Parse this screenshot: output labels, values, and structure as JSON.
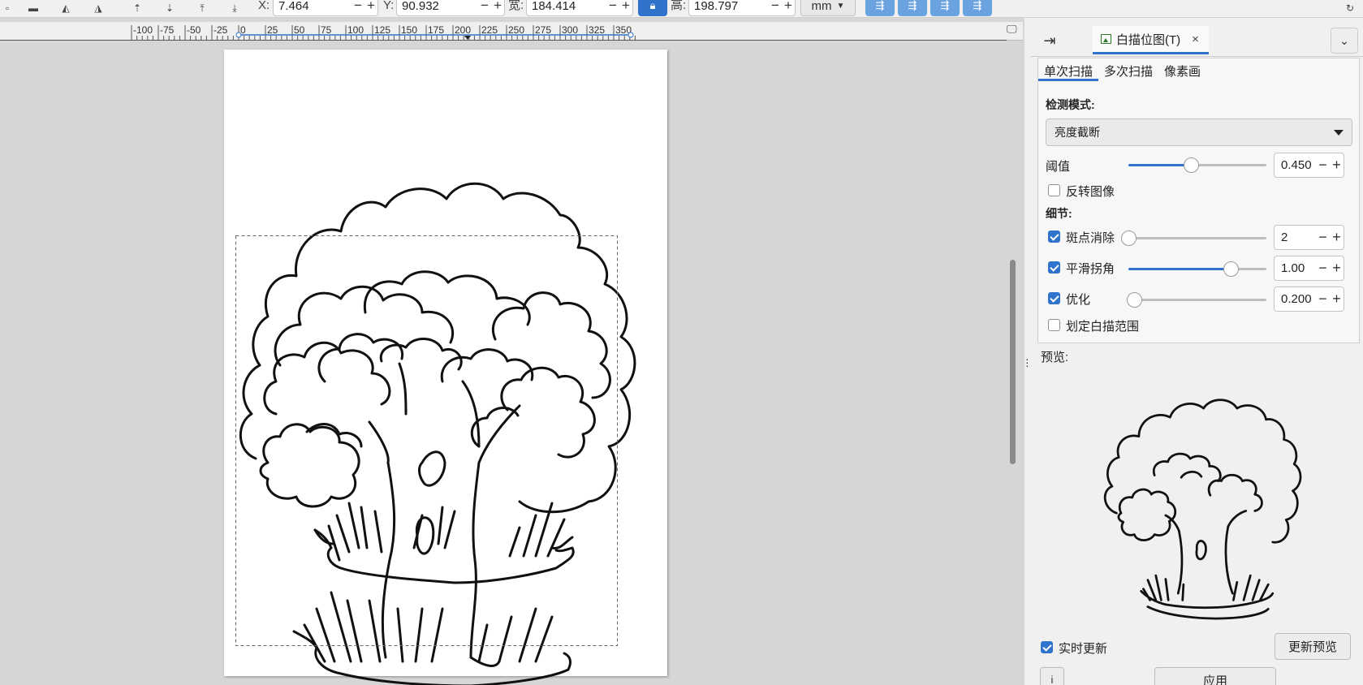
{
  "toolbar": {
    "x_label": "X:",
    "x_value": "7.464",
    "y_label": "Y:",
    "y_value": "90.932",
    "w_label": "宽:",
    "w_value": "184.414",
    "h_label": "高:",
    "h_value": "198.797",
    "unit": "mm",
    "minus": "−",
    "plus": "+"
  },
  "ruler": {
    "ticks": [
      "-100",
      "-75",
      "-50",
      "-25",
      "0",
      "25",
      "50",
      "75",
      "100",
      "125",
      "150",
      "175",
      "200",
      "225",
      "250",
      "275",
      "300",
      "325",
      "350"
    ]
  },
  "dock": {
    "active_tab": "白描位图(T)",
    "close": "×",
    "mode_tabs": [
      "单次扫描",
      "多次扫描",
      "像素画"
    ],
    "detection_label": "检测模式:",
    "detection_value": "亮度截断",
    "threshold_label": "阈值",
    "threshold_value": "0.450",
    "threshold_fraction": 0.45,
    "invert_label": "反转图像",
    "invert_checked": false,
    "details_label": "细节:",
    "speckles_label": "斑点消除",
    "speckles_value": "2",
    "speckles_checked": true,
    "speckles_fraction": 0.0,
    "smooth_label": "平滑拐角",
    "smooth_value": "1.00",
    "smooth_checked": true,
    "smooth_fraction": 0.74,
    "optimize_label": "优化",
    "optimize_value": "0.200",
    "optimize_checked": true,
    "optimize_fraction": 0.04,
    "area_label": "划定白描范围",
    "area_checked": false,
    "preview_label": "预览:",
    "live_update_label": "实时更新",
    "live_update_checked": true,
    "update_preview_button": "更新预览",
    "apply_button": "应用",
    "info_icon": "i"
  },
  "colors": {
    "accent": "#2f73cc",
    "panel_bg": "#f0f0f0",
    "canvas_bg": "#d6d6d6"
  }
}
